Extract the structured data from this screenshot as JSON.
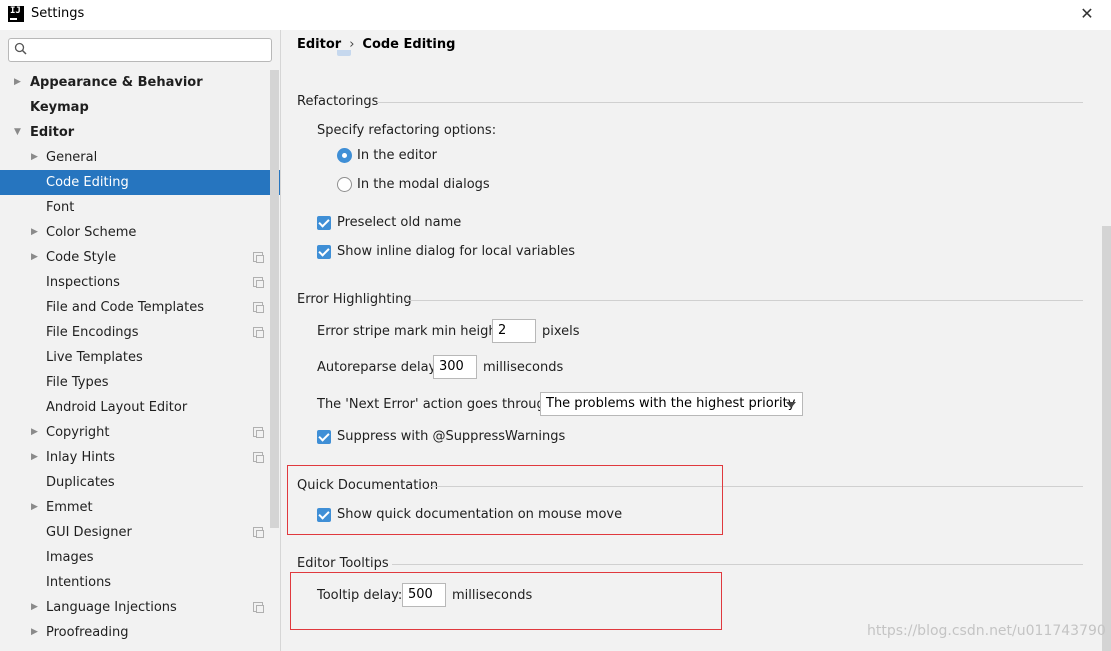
{
  "window": {
    "title": "Settings",
    "close_glyph": "✕"
  },
  "search": {
    "placeholder": "",
    "value": ""
  },
  "sidebar": {
    "items": [
      {
        "label": "Appearance & Behavior",
        "level": 0,
        "arrow": "▶"
      },
      {
        "label": "Keymap",
        "level": 0,
        "arrow": ""
      },
      {
        "label": "Editor",
        "level": 0,
        "arrow": "▼"
      },
      {
        "label": "General",
        "level": 1,
        "arrow": "▶"
      },
      {
        "label": "Code Editing",
        "level": 1,
        "arrow": "",
        "selected": true
      },
      {
        "label": "Font",
        "level": 1,
        "arrow": ""
      },
      {
        "label": "Color Scheme",
        "level": 1,
        "arrow": "▶"
      },
      {
        "label": "Code Style",
        "level": 1,
        "arrow": "▶",
        "copy": true
      },
      {
        "label": "Inspections",
        "level": 1,
        "arrow": "",
        "copy": true
      },
      {
        "label": "File and Code Templates",
        "level": 1,
        "arrow": "",
        "copy": true
      },
      {
        "label": "File Encodings",
        "level": 1,
        "arrow": "",
        "copy": true
      },
      {
        "label": "Live Templates",
        "level": 1,
        "arrow": ""
      },
      {
        "label": "File Types",
        "level": 1,
        "arrow": ""
      },
      {
        "label": "Android Layout Editor",
        "level": 1,
        "arrow": ""
      },
      {
        "label": "Copyright",
        "level": 1,
        "arrow": "▶",
        "copy": true
      },
      {
        "label": "Inlay Hints",
        "level": 1,
        "arrow": "▶",
        "copy": true
      },
      {
        "label": "Duplicates",
        "level": 1,
        "arrow": ""
      },
      {
        "label": "Emmet",
        "level": 1,
        "arrow": "▶"
      },
      {
        "label": "GUI Designer",
        "level": 1,
        "arrow": "",
        "copy": true
      },
      {
        "label": "Images",
        "level": 1,
        "arrow": ""
      },
      {
        "label": "Intentions",
        "level": 1,
        "arrow": ""
      },
      {
        "label": "Language Injections",
        "level": 1,
        "arrow": "▶",
        "copy": true
      },
      {
        "label": "Proofreading",
        "level": 1,
        "arrow": "▶"
      }
    ]
  },
  "breadcrumb": {
    "root": "Editor",
    "separator": "›",
    "current": "Code Editing"
  },
  "refactorings": {
    "title": "Refactorings",
    "options_label": "Specify refactoring options:",
    "radio_editor": "In the editor",
    "radio_modal": "In the modal dialogs",
    "selected": "editor",
    "preselect_label": "Preselect old name",
    "preselect_checked": true,
    "inline_dialog_label": "Show inline dialog for local variables",
    "inline_dialog_checked": true
  },
  "error_highlighting": {
    "title": "Error Highlighting",
    "stripe_label": "Error stripe mark min height:",
    "stripe_value": "2",
    "stripe_unit": "pixels",
    "reparse_label": "Autoreparse delay:",
    "reparse_value": "300",
    "reparse_unit": "milliseconds",
    "next_error_label": "The 'Next Error' action goes through:",
    "next_error_value": "The problems with the highest priority",
    "suppress_label": "Suppress with @SuppressWarnings",
    "suppress_checked": true
  },
  "quick_documentation": {
    "title": "Quick Documentation",
    "mouse_move_label": "Show quick documentation on mouse move",
    "mouse_move_checked": true
  },
  "editor_tooltips": {
    "title": "Editor Tooltips",
    "delay_label": "Tooltip delay:",
    "delay_value": "500",
    "delay_unit": "milliseconds"
  },
  "watermark": "https://blog.csdn.net/u011743790",
  "colors": {
    "accent": "#3f8fd6",
    "selection": "#2675bf",
    "highlight": "#e0393e"
  }
}
